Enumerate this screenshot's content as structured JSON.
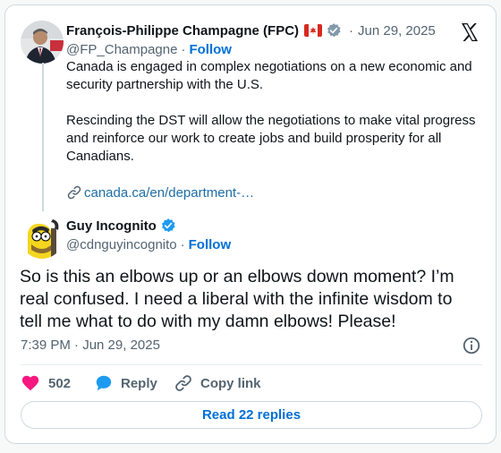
{
  "tweet_parent": {
    "author_name": "François-Philippe Champagne (FPC)",
    "flag": "🇨🇦",
    "date": "Jun 29, 2025",
    "handle": "@FP_Champagne",
    "follow_label": "Follow",
    "dot": "·",
    "paragraph1_line1": "Canada is engaged in complex negotiations on a new economic and",
    "paragraph1_line2": "security partnership with the U.S.",
    "paragraph2_line1": "Rescinding the DST will allow the negotiations to make vital progress",
    "paragraph2_line2": "and reinforce our work to create jobs and build prosperity for all",
    "paragraph2_line3": "Canadians.",
    "link_text": "canada.ca/en/department-…"
  },
  "tweet_reply": {
    "author_name": "Guy Incognito",
    "handle": "@cdnguyincognito",
    "follow_label": "Follow",
    "dot": "·",
    "text_line1": "So is this an elbows up or an elbows down moment? I’m",
    "text_line2": "real confused. I need a liberal with the infinite wisdom to",
    "text_line3": "tell me what to do with my damn elbows! Please!",
    "timestamp": "7:39 PM · Jun 29, 2025"
  },
  "actions": {
    "likes": "502",
    "reply_label": "Reply",
    "copy_label": "Copy link",
    "read_replies_label": "Read 22 replies"
  },
  "colors": {
    "verified": "#1d9bf0",
    "like": "#f91880",
    "link": "#006fd6"
  },
  "icons": [
    "x-logo-icon",
    "verified-badge-icon",
    "link-icon",
    "info-icon",
    "heart-icon",
    "reply-bubble-icon",
    "copy-link-icon"
  ]
}
